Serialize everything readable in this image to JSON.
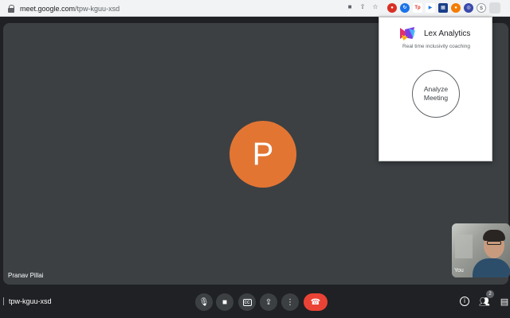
{
  "browser": {
    "url_host": "meet.google.com",
    "url_path": "/tpw-kguu-xsd"
  },
  "stage": {
    "avatar_letter": "P",
    "participant_name": "Pranav Pillai",
    "avatar_color": "#e37533"
  },
  "self_tile": {
    "label": "You"
  },
  "extension_popup": {
    "title": "Lex Analytics",
    "subtitle": "Real time inclusivity coaching",
    "analyze_line1": "Analyze",
    "analyze_line2": "Meeting"
  },
  "bottom_bar": {
    "meeting_code": "tpw-kguu-xsd",
    "people_count": "2",
    "end_call_color": "#ea4335"
  }
}
